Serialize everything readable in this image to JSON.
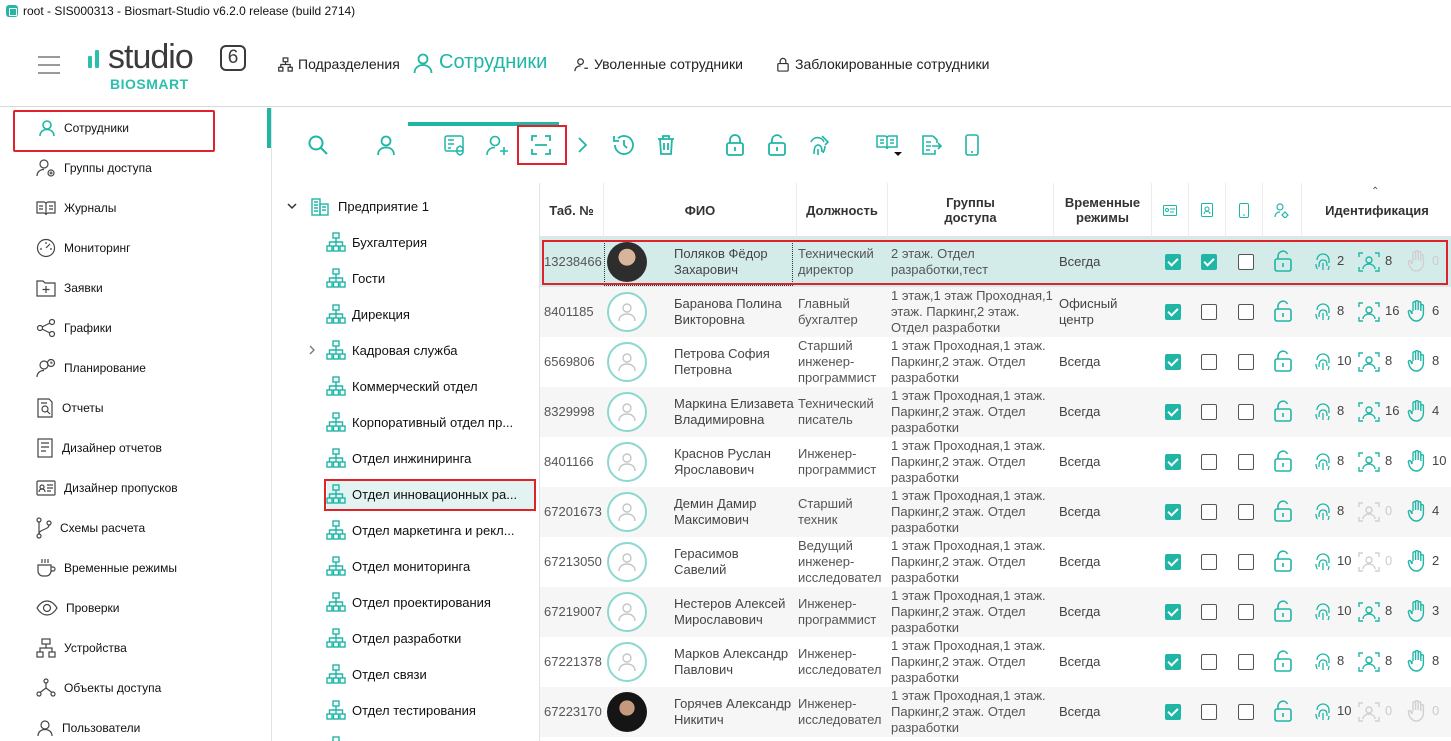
{
  "window": {
    "title": "root - SIS000313 - Biosmart-Studio v6.2.0 release (build 2714)"
  },
  "logo": {
    "word": "studio",
    "version": "6",
    "brand": "BIOSMART"
  },
  "nav": {
    "tabs": [
      {
        "label": "Подразделения",
        "icon": "hierarchy-icon"
      },
      {
        "label": "Сотрудники",
        "icon": "user-icon",
        "active": true
      },
      {
        "label": "Уволенные сотрудники",
        "icon": "user-minus-icon"
      },
      {
        "label": "Заблокированные сотрудники",
        "icon": "lock-icon"
      }
    ]
  },
  "sidebar": {
    "items": [
      {
        "label": "Сотрудники",
        "icon": "user-icon",
        "active": true
      },
      {
        "label": "Группы доступа",
        "icon": "group-access-icon"
      },
      {
        "label": "Журналы",
        "icon": "book-icon"
      },
      {
        "label": "Мониторинг",
        "icon": "gauge-icon"
      },
      {
        "label": "Заявки",
        "icon": "folder-plus-icon"
      },
      {
        "label": "Графики",
        "icon": "share-graph-icon"
      },
      {
        "label": "Планирование",
        "icon": "user-clock-icon"
      },
      {
        "label": "Отчеты",
        "icon": "report-icon"
      },
      {
        "label": "Дизайнер отчетов",
        "icon": "report-designer-icon"
      },
      {
        "label": "Дизайнер пропусков",
        "icon": "badge-designer-icon"
      },
      {
        "label": "Схемы расчета",
        "icon": "branch-icon"
      },
      {
        "label": "Временные режимы",
        "icon": "cup-icon"
      },
      {
        "label": "Проверки",
        "icon": "eye-icon"
      },
      {
        "label": "Устройства",
        "icon": "devices-icon"
      },
      {
        "label": "Объекты доступа",
        "icon": "objects-icon"
      },
      {
        "label": "Пользователи",
        "icon": "user-icon"
      }
    ]
  },
  "toolbar": {
    "buttons": [
      "search-icon",
      "user-icon",
      "user-card-icon",
      "user-add-icon",
      "scan-face-icon",
      "chevron-right-icon",
      "history-icon",
      "trash-icon",
      "lock-icon",
      "unlock-icon",
      "fingerprint-tag-icon",
      "book-dropdown-icon",
      "export-icon",
      "mobile-icon"
    ]
  },
  "tree": {
    "root": "Предприятие 1",
    "nodes": [
      {
        "label": "Бухгалтерия"
      },
      {
        "label": "Гости"
      },
      {
        "label": "Дирекция"
      },
      {
        "label": "Кадровая служба",
        "expandable": true
      },
      {
        "label": "Коммерческий отдел"
      },
      {
        "label": "Корпоративный отдел пр..."
      },
      {
        "label": "Отдел инжиниринга"
      },
      {
        "label": "Отдел инновационных ра...",
        "selected": true
      },
      {
        "label": "Отдел маркетинга и рекл..."
      },
      {
        "label": "Отдел мониторинга"
      },
      {
        "label": "Отдел проектирования"
      },
      {
        "label": "Отдел разработки"
      },
      {
        "label": "Отдел связи"
      },
      {
        "label": "Отдел тестирования"
      }
    ]
  },
  "table": {
    "columns": {
      "tab": "Таб. №",
      "fio": "ФИО",
      "position": "Должность",
      "groups_1": "Группы",
      "groups_2": "доступа",
      "modes_1": "Временные",
      "modes_2": "режимы",
      "ident": "Идентификация",
      "col_icons": [
        "card-icon",
        "badge-icon",
        "mobile-icon",
        "user-lock-icon"
      ]
    },
    "rows": [
      {
        "tab": "13238466",
        "fio": "Поляков Фёдор Захарович",
        "position": "Технический директор",
        "groups": "2 этаж. Отдел разработки,тест",
        "mode": "Всегда",
        "c1": true,
        "c2": true,
        "c3": false,
        "fp": "2",
        "face": "8",
        "palm": "0",
        "photo": true
      },
      {
        "tab": "8401185",
        "fio": "Баранова Полина Викторовна",
        "position": "Главный бухгалтер",
        "groups": "1 этаж,1 этаж Проходная,1 этаж. Паркинг,2 этаж. Отдел разработки",
        "mode": "Офисный центр",
        "c1": true,
        "c2": false,
        "c3": false,
        "fp": "8",
        "face": "16",
        "palm": "6"
      },
      {
        "tab": "6569806",
        "fio": "Петрова София Петровна",
        "position": "Старший инженер-программист",
        "groups": "1 этаж Проходная,1 этаж. Паркинг,2 этаж. Отдел разработки",
        "mode": "Всегда",
        "c1": true,
        "c2": false,
        "c3": false,
        "fp": "10",
        "face": "8",
        "palm": "8"
      },
      {
        "tab": "8329998",
        "fio": "Маркина Елизавета Владимировна",
        "position": "Технический писатель",
        "groups": "1 этаж Проходная,1 этаж. Паркинг,2 этаж. Отдел разработки",
        "mode": "Всегда",
        "c1": true,
        "c2": false,
        "c3": false,
        "fp": "8",
        "face": "16",
        "palm": "4"
      },
      {
        "tab": "8401166",
        "fio": "Краснов Руслан Ярославович",
        "position": "Инженер-программист",
        "groups": "1 этаж Проходная,1 этаж. Паркинг,2 этаж. Отдел разработки",
        "mode": "Всегда",
        "c1": true,
        "c2": false,
        "c3": false,
        "fp": "8",
        "face": "8",
        "palm": "10"
      },
      {
        "tab": "67201673",
        "fio": "Демин Дамир Максимович",
        "position": "Старший техник",
        "groups": "1 этаж Проходная,1 этаж. Паркинг,2 этаж. Отдел разработки",
        "mode": "Всегда",
        "c1": true,
        "c2": false,
        "c3": false,
        "fp": "8",
        "face": "0",
        "palm": "4"
      },
      {
        "tab": "67213050",
        "fio": "Герасимов Савелий",
        "position": "Ведущий инженер-исследовател",
        "groups": "1 этаж Проходная,1 этаж. Паркинг,2 этаж. Отдел разработки",
        "mode": "Всегда",
        "c1": true,
        "c2": false,
        "c3": false,
        "fp": "10",
        "face": "0",
        "palm": "2"
      },
      {
        "tab": "67219007",
        "fio": "Нестеров Алексей Мирославович",
        "position": "Инженер-программист",
        "groups": "1 этаж Проходная,1 этаж. Паркинг,2 этаж. Отдел разработки",
        "mode": "Всегда",
        "c1": true,
        "c2": false,
        "c3": false,
        "fp": "10",
        "face": "8",
        "palm": "3"
      },
      {
        "tab": "67221378",
        "fio": "Марков Александр Павлович",
        "position": "Инженер-исследовател",
        "groups": "1 этаж Проходная,1 этаж. Паркинг,2 этаж. Отдел разработки",
        "mode": "Всегда",
        "c1": true,
        "c2": false,
        "c3": false,
        "fp": "8",
        "face": "8",
        "palm": "8"
      },
      {
        "tab": "67223170",
        "fio": "Горячев Александр Никитич",
        "position": "Инженер-исследовател",
        "groups": "1 этаж Проходная,1 этаж. Паркинг,2 этаж. Отдел разработки",
        "mode": "Всегда",
        "c1": true,
        "c2": false,
        "c3": false,
        "fp": "10",
        "face": "0",
        "palm": "0",
        "photo": true
      }
    ]
  },
  "colors": {
    "accent": "#1fb6a6",
    "highlight": "#e0222c",
    "selected_row": "#d4ece9"
  }
}
